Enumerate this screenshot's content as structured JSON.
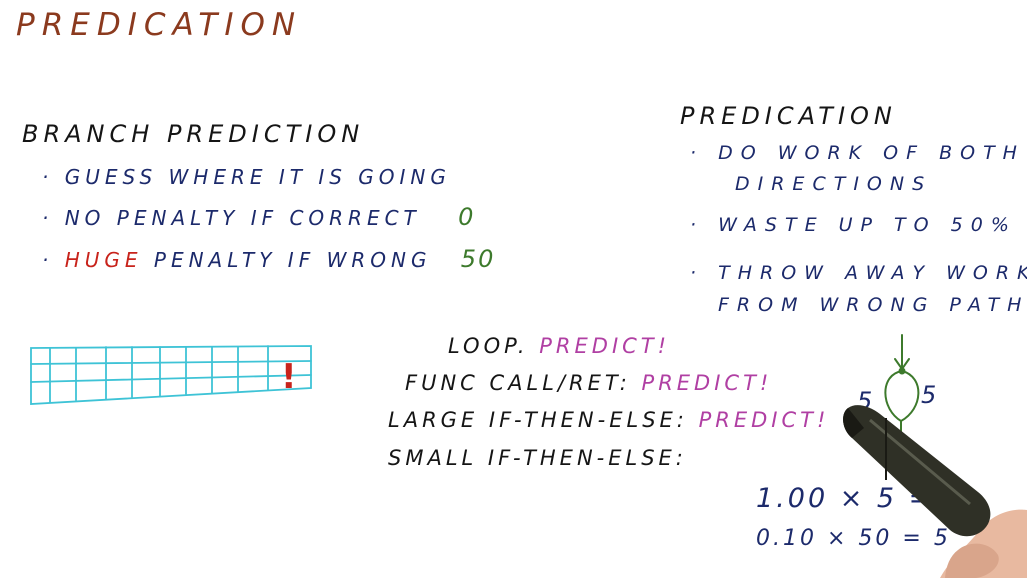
{
  "title": "PREDICATION",
  "branch_prediction": {
    "heading": "BRANCH PREDICTION",
    "bullets": [
      {
        "marker": "·",
        "text": "GUESS WHERE IT IS GOING"
      },
      {
        "marker": "·",
        "text": "NO PENALTY IF CORRECT",
        "value": "0"
      },
      {
        "marker": "·",
        "emphasis": "HUGE",
        "text": " PENALTY IF WRONG",
        "value": "50"
      }
    ]
  },
  "predication": {
    "heading": "PREDICATION",
    "bullets": [
      {
        "marker": "·",
        "line1": "DO WORK OF BOTH",
        "line2": "DIRECTIONS"
      },
      {
        "marker": "·",
        "line1": "WASTE UP TO 50%"
      },
      {
        "marker": "·",
        "line1": "THROW AWAY WORK",
        "line2": "FROM WRONG PATH"
      }
    ]
  },
  "cases": [
    {
      "label": "LOOP.",
      "verdict": "PREDICT!"
    },
    {
      "label": "FUNC CALL/RET:",
      "verdict": "PREDICT!"
    },
    {
      "label": "LARGE IF-THEN-ELSE:",
      "verdict": "PREDICT!"
    },
    {
      "label": "SMALL IF-THEN-ELSE:",
      "verdict": ""
    }
  ],
  "pipeline_table": {
    "marker": "!",
    "color": "#3ec3d6",
    "marker_color": "#c8231b"
  },
  "hammock": {
    "left_label": "5",
    "right_label": "5",
    "color": "#3d7a2c"
  },
  "calculations": [
    "1.00 × 5 = 5",
    "0.10 × 50 = 5"
  ],
  "colors": {
    "title": "#8b3a1e",
    "text": "#151515",
    "bullets": "#1c2a6b",
    "emphasis": "#c8231b",
    "values": "#3d7a2c",
    "verdict": "#b03fa3"
  }
}
